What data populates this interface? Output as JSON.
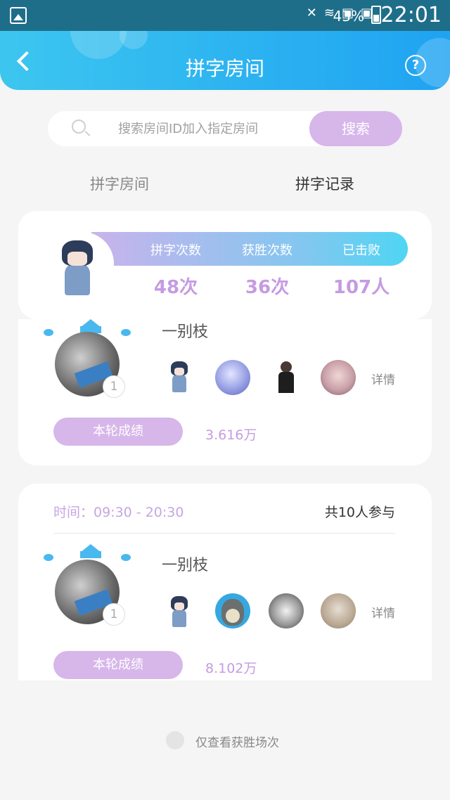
{
  "status_bar": {
    "battery": "43%",
    "time": "22:01"
  },
  "header": {
    "title": "拼字房间",
    "help_label": "?"
  },
  "search": {
    "placeholder": "搜索房间ID加入指定房间",
    "button_label": "搜索"
  },
  "tabs": [
    {
      "label": "拼字房间",
      "active": false
    },
    {
      "label": "拼字记录",
      "active": true
    }
  ],
  "stats": {
    "items": [
      {
        "label": "拼字次数",
        "value": "48次"
      },
      {
        "label": "获胜次数",
        "value": "36次"
      },
      {
        "label": "已击败",
        "value": "107人"
      }
    ]
  },
  "records": [
    {
      "winner_name": "一别枝",
      "rank": "1",
      "details_label": "详情",
      "score_label": "本轮成绩",
      "score_value": "3.616万"
    },
    {
      "time_label": "时间：09:30 - 20:30",
      "participants": "共10人参与",
      "winner_name": "一别枝",
      "rank": "1",
      "details_label": "详情",
      "score_label": "本轮成绩",
      "score_value": "8.102万"
    }
  ],
  "footer": {
    "filter_label": "仅查看获胜场次"
  },
  "colors": {
    "accent_purple": "#d7b6ea",
    "value_purple": "#c69be2",
    "header_blue": "#1fa3f2",
    "crown_blue": "#49b8ef"
  }
}
